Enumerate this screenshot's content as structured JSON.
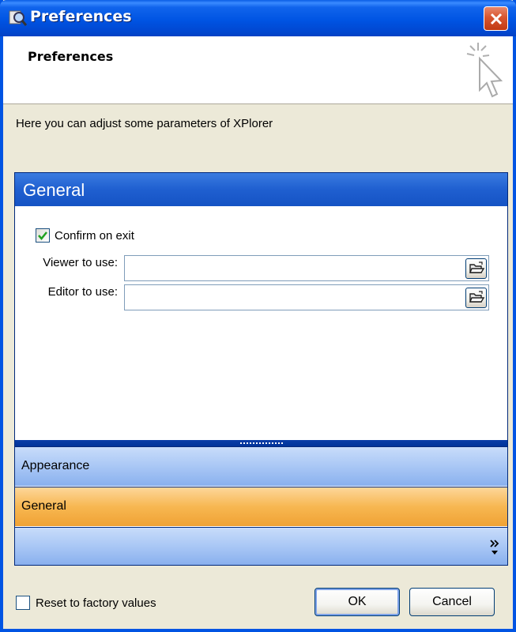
{
  "window": {
    "title": "Preferences",
    "accent": "#0054e3",
    "close_color": "#d8552f"
  },
  "header": {
    "title": "Preferences",
    "icon": "pointer-sparkle-icon"
  },
  "description": "Here you can adjust some parameters of XPlorer",
  "panel": {
    "title": "General",
    "confirm_on_exit": {
      "label": "Confirm on exit",
      "checked": true
    },
    "viewer": {
      "label": "Viewer to use:",
      "value": ""
    },
    "editor": {
      "label": "Editor to use:",
      "value": ""
    },
    "nav": [
      {
        "label": "Appearance",
        "active": false
      },
      {
        "label": "General",
        "active": true
      }
    ],
    "active_color": "#f7b751",
    "nav_color": "#a9c7f5"
  },
  "footer": {
    "reset_label": "Reset to factory values",
    "reset_checked": false,
    "ok_label": "OK",
    "cancel_label": "Cancel"
  }
}
